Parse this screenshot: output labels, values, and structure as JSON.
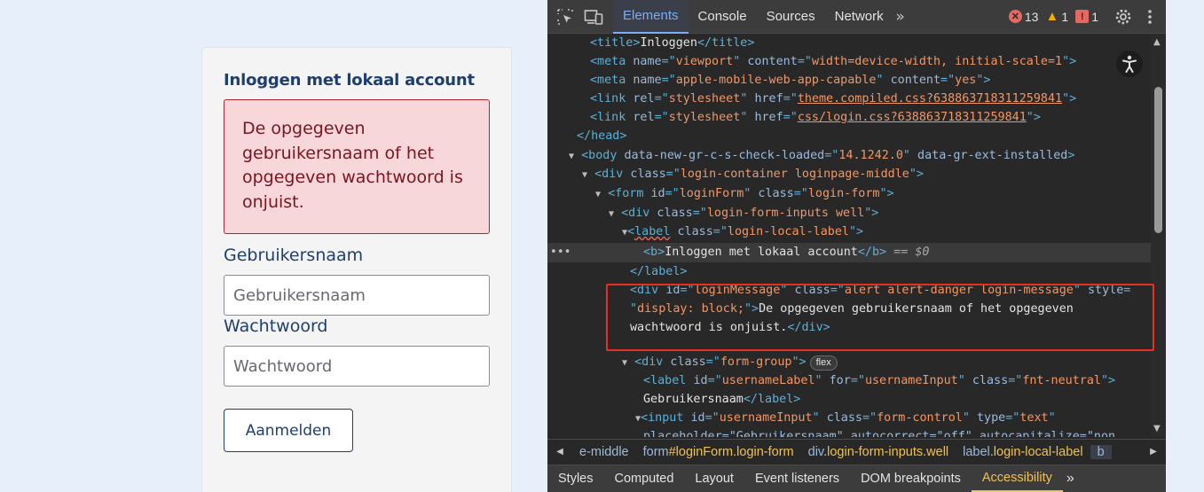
{
  "login": {
    "title": "Inloggen met lokaal account",
    "alert": "De opgegeven gebruikersnaam of het opgegeven wachtwoord is onjuist.",
    "username_label": "Gebruikersnaam",
    "username_placeholder": "Gebruikersnaam",
    "password_label": "Wachtwoord",
    "password_placeholder": "Wachtwoord",
    "submit": "Aanmelden"
  },
  "devtools": {
    "tabs": [
      "Elements",
      "Console",
      "Sources",
      "Network"
    ],
    "active_tab": "Elements",
    "errors": "13",
    "warnings": "1",
    "messages": "1",
    "code": {
      "title_text": "Inloggen",
      "meta_viewport_content": "width=device-width, initial-scale=1",
      "meta_apple_name": "apple-mobile-web-app-capable",
      "meta_apple_content": "yes",
      "link1_href": "theme.compiled.css?638863718311259841",
      "link2_href": "css/login.css?638863718311259841",
      "body_check": "14.1242.0",
      "div1_class": "login-container loginpage-middle",
      "form_id": "loginForm",
      "form_class": "login-form",
      "div2_class": "login-form-inputs well",
      "label_class": "login-local-label",
      "b_text": "Inloggen met lokaal account",
      "dollar0": "== $0",
      "msg_id": "loginMessage",
      "msg_class": "alert alert-danger login-message",
      "msg_style": "display: block;",
      "msg_text1": "De opgegeven gebruikersnaam of het opgegeven",
      "msg_text2": "wachtwoord is onjuist.",
      "formgroup_class": "form-group",
      "flex_badge": "flex",
      "ulabel_id": "usernameLabel",
      "ulabel_for": "usernameInput",
      "ulabel_class": "fnt-neutral",
      "ulabel_text": "Gebruikersnaam",
      "input_id": "usernameInput",
      "input_class": "form-control",
      "input_type": "text",
      "input_line2": "placeholder=\"Gebruikersnaam\" autocorrect=\"off\" autocapitalize=\"non"
    },
    "breadcrumbs": [
      {
        "tag": "e-middle",
        "cls": ""
      },
      {
        "tag": "form",
        "cls": "#loginForm.login-form"
      },
      {
        "tag": "div",
        "cls": ".login-form-inputs.well"
      },
      {
        "tag": "label",
        "cls": ".login-local-label"
      },
      {
        "tag": "b",
        "cls": ""
      }
    ],
    "bottom_tabs": [
      "Styles",
      "Computed",
      "Layout",
      "Event listeners",
      "DOM breakpoints",
      "Accessibility"
    ],
    "bottom_active": "Accessibility"
  },
  "colors": {
    "accent": "#7cacf8",
    "highlight": "#e5311e",
    "login_blue": "#1e3f6c",
    "alert_bg": "#f8d7da"
  },
  "icons": [
    "inspect-element-icon",
    "device-toolbar-icon",
    "more-tabs-icon",
    "error-icon",
    "warning-icon",
    "message-icon",
    "settings-gear-icon",
    "kebab-menu-icon",
    "accessibility-icon",
    "chevron-left-icon",
    "chevron-right-icon"
  ]
}
